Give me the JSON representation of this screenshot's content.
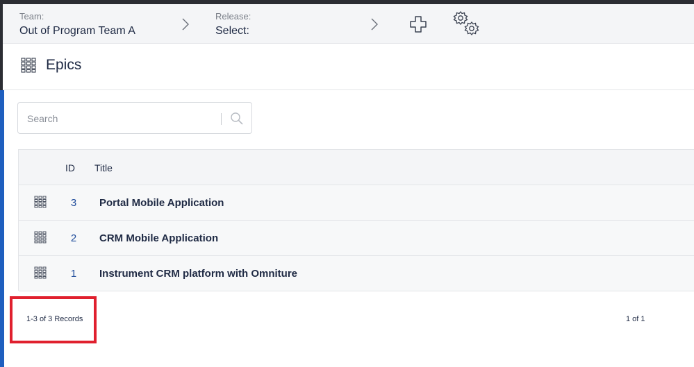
{
  "header": {
    "team_label": "Team:",
    "team_value": "Out of Program Team A",
    "release_label": "Release:",
    "release_value": "Select:"
  },
  "page": {
    "title": "Epics"
  },
  "search": {
    "placeholder": "Search",
    "value": ""
  },
  "table": {
    "columns": {
      "id": "ID",
      "title": "Title"
    },
    "rows": [
      {
        "id": "3",
        "title": "Portal Mobile Application"
      },
      {
        "id": "2",
        "title": "CRM Mobile Application"
      },
      {
        "id": "1",
        "title": "Instrument CRM platform with Omniture"
      }
    ]
  },
  "footer": {
    "records": "1-3 of 3 Records",
    "pages": "1 of 1"
  },
  "colors": {
    "accent_blue": "#1f4c9b",
    "highlight_red": "#e0202e",
    "header_bg": "#f4f5f7"
  },
  "icons": [
    "chevron-right-icon",
    "plus-icon",
    "gears-icon",
    "grid-icon",
    "search-icon"
  ]
}
